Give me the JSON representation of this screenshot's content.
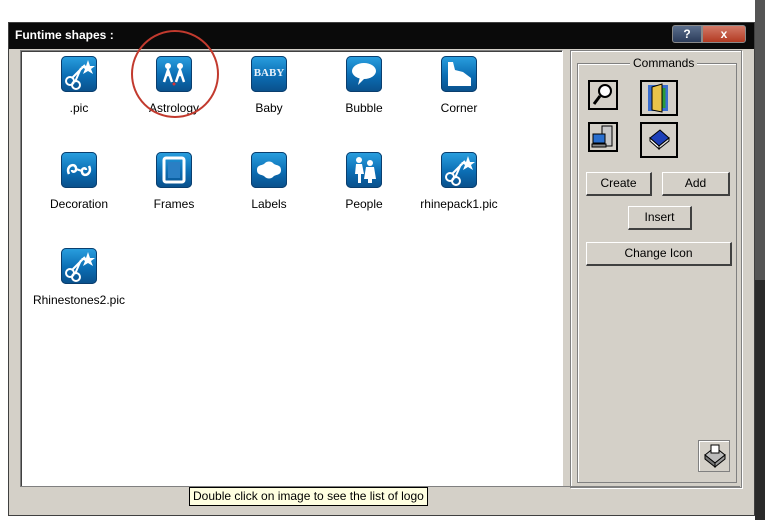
{
  "window": {
    "title": "Funtime shapes :",
    "help_glyph": "?",
    "close_glyph": "x"
  },
  "shapes": [
    {
      "label": ".pic",
      "icon": "scissors-star-icon"
    },
    {
      "label": "Astrology",
      "icon": "twins-icon"
    },
    {
      "label": "Baby",
      "icon": "baby-text-icon"
    },
    {
      "label": "Bubble",
      "icon": "speech-bubble-icon"
    },
    {
      "label": "Corner",
      "icon": "corner-icon"
    },
    {
      "label": "Decoration",
      "icon": "swirl-icon"
    },
    {
      "label": "Frames",
      "icon": "frame-icon"
    },
    {
      "label": "Labels",
      "icon": "label-icon"
    },
    {
      "label": "People",
      "icon": "people-icon"
    },
    {
      "label": "rhinepack1.pic",
      "icon": "scissors-star-icon"
    },
    {
      "label": "Rhinestones2.pic",
      "icon": "scissors-star-icon"
    }
  ],
  "baby_icon_text": "BABY",
  "commands": {
    "legend": "Commands",
    "toolbar_icons": [
      "magnifier-icon",
      "door-icon",
      "computer-icon",
      "eraser-icon"
    ],
    "create_label": "Create",
    "add_label": "Add",
    "insert_label": "Insert",
    "change_icon_label": "Change Icon",
    "printer_icon": "printer-icon"
  },
  "tooltip": "Double click on image to see the list of logo"
}
